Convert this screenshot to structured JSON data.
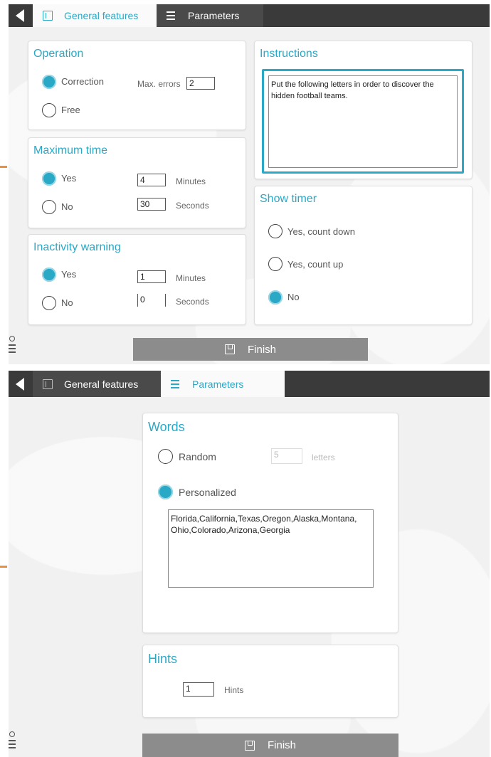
{
  "screen1": {
    "tabs": {
      "general": "General features",
      "parameters": "Parameters"
    },
    "operation": {
      "title": "Operation",
      "correction": "Correction",
      "free": "Free",
      "max_errors_label": "Max. errors",
      "max_errors_value": "2",
      "selected": "correction"
    },
    "max_time": {
      "title": "Maximum time",
      "yes": "Yes",
      "no": "No",
      "minutes_value": "4",
      "minutes_label": "Minutes",
      "seconds_value": "30",
      "seconds_label": "Seconds",
      "selected": "yes"
    },
    "inactivity": {
      "title": "Inactivity warning",
      "yes": "Yes",
      "no": "No",
      "minutes_value": "1",
      "minutes_label": "Minutes",
      "seconds_value": "0",
      "seconds_label": "Seconds",
      "selected": "yes"
    },
    "instructions": {
      "title": "Instructions",
      "text": "Put the following letters in order to discover the hidden football teams."
    },
    "show_timer": {
      "title": "Show timer",
      "count_down": "Yes, count down",
      "count_up": "Yes, count up",
      "no": "No",
      "selected": "no"
    },
    "finish_label": "Finish"
  },
  "screen2": {
    "tabs": {
      "general": "General features",
      "parameters": "Parameters"
    },
    "words": {
      "title": "Words",
      "random": "Random",
      "letters_value": "5",
      "letters_label": "letters",
      "personalized": "Personalized",
      "list_text": "Florida,California,Texas,Oregon,Alaska,Montana,\nOhio,Colorado,Arizona,Georgia",
      "selected": "personalized"
    },
    "hints": {
      "title": "Hints",
      "value": "1",
      "label": "Hints"
    },
    "finish_label": "Finish"
  },
  "colors": {
    "accent": "#2aa9c6",
    "topbar": "#3a3a3a",
    "finish": "#8c8c8c",
    "edge_marker": "#e8903a"
  }
}
